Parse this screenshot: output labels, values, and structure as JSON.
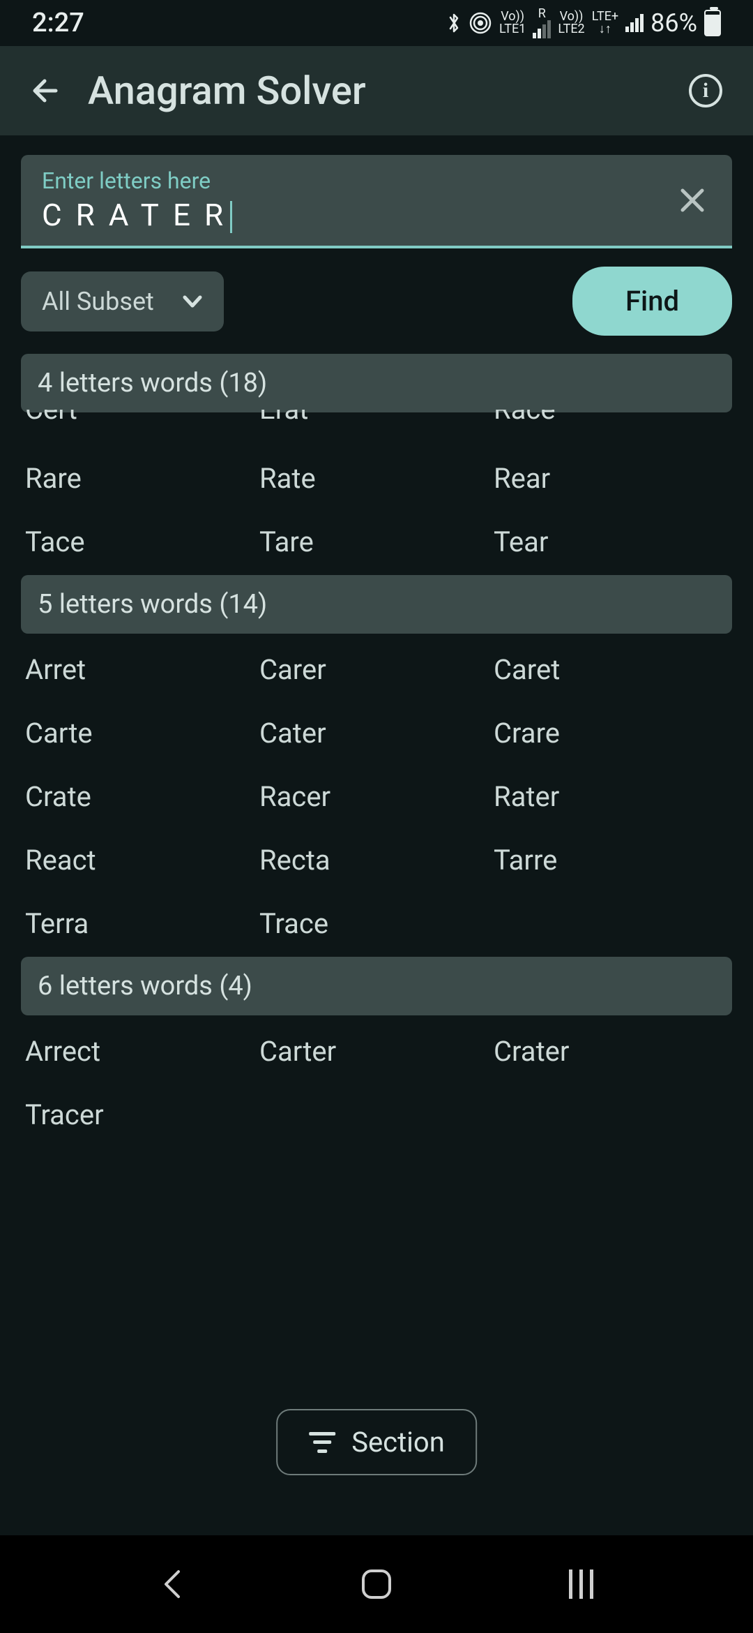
{
  "status": {
    "time": "2:27",
    "lte1_top": "Vo))",
    "lte1_mid": "R",
    "lte1_bot": "LTE1",
    "lte2_top": "Vo))",
    "lte2_mid": "LTE+",
    "lte2_bot": "LTE2",
    "battery": "86%"
  },
  "appbar": {
    "title": "Anagram Solver"
  },
  "input": {
    "label": "Enter letters here",
    "value": "CRATER"
  },
  "controls": {
    "dropdown": "All Subset",
    "find": "Find"
  },
  "sections": {
    "s4": {
      "header": "4 letters words (18)",
      "words_partial": [
        "Cert",
        "Erat",
        "Race"
      ],
      "words": [
        "Rare",
        "Rate",
        "Rear",
        "Tace",
        "Tare",
        "Tear"
      ]
    },
    "s5": {
      "header": "5 letters words (14)",
      "words": [
        "Arret",
        "Carer",
        "Caret",
        "Carte",
        "Cater",
        "Crare",
        "Crate",
        "Racer",
        "Rater",
        "React",
        "Recta",
        "Tarre",
        "Terra",
        "Trace"
      ]
    },
    "s6": {
      "header": "6 letters words (4)",
      "words": [
        "Arrect",
        "Carter",
        "Crater",
        "Tracer"
      ]
    }
  },
  "section_button": "Section",
  "colors": {
    "bg": "#0d1617",
    "panel": "#3c4b4a",
    "accent": "#80cbc4",
    "accent_button": "#8fd7cf",
    "text": "#d6e2e0"
  }
}
